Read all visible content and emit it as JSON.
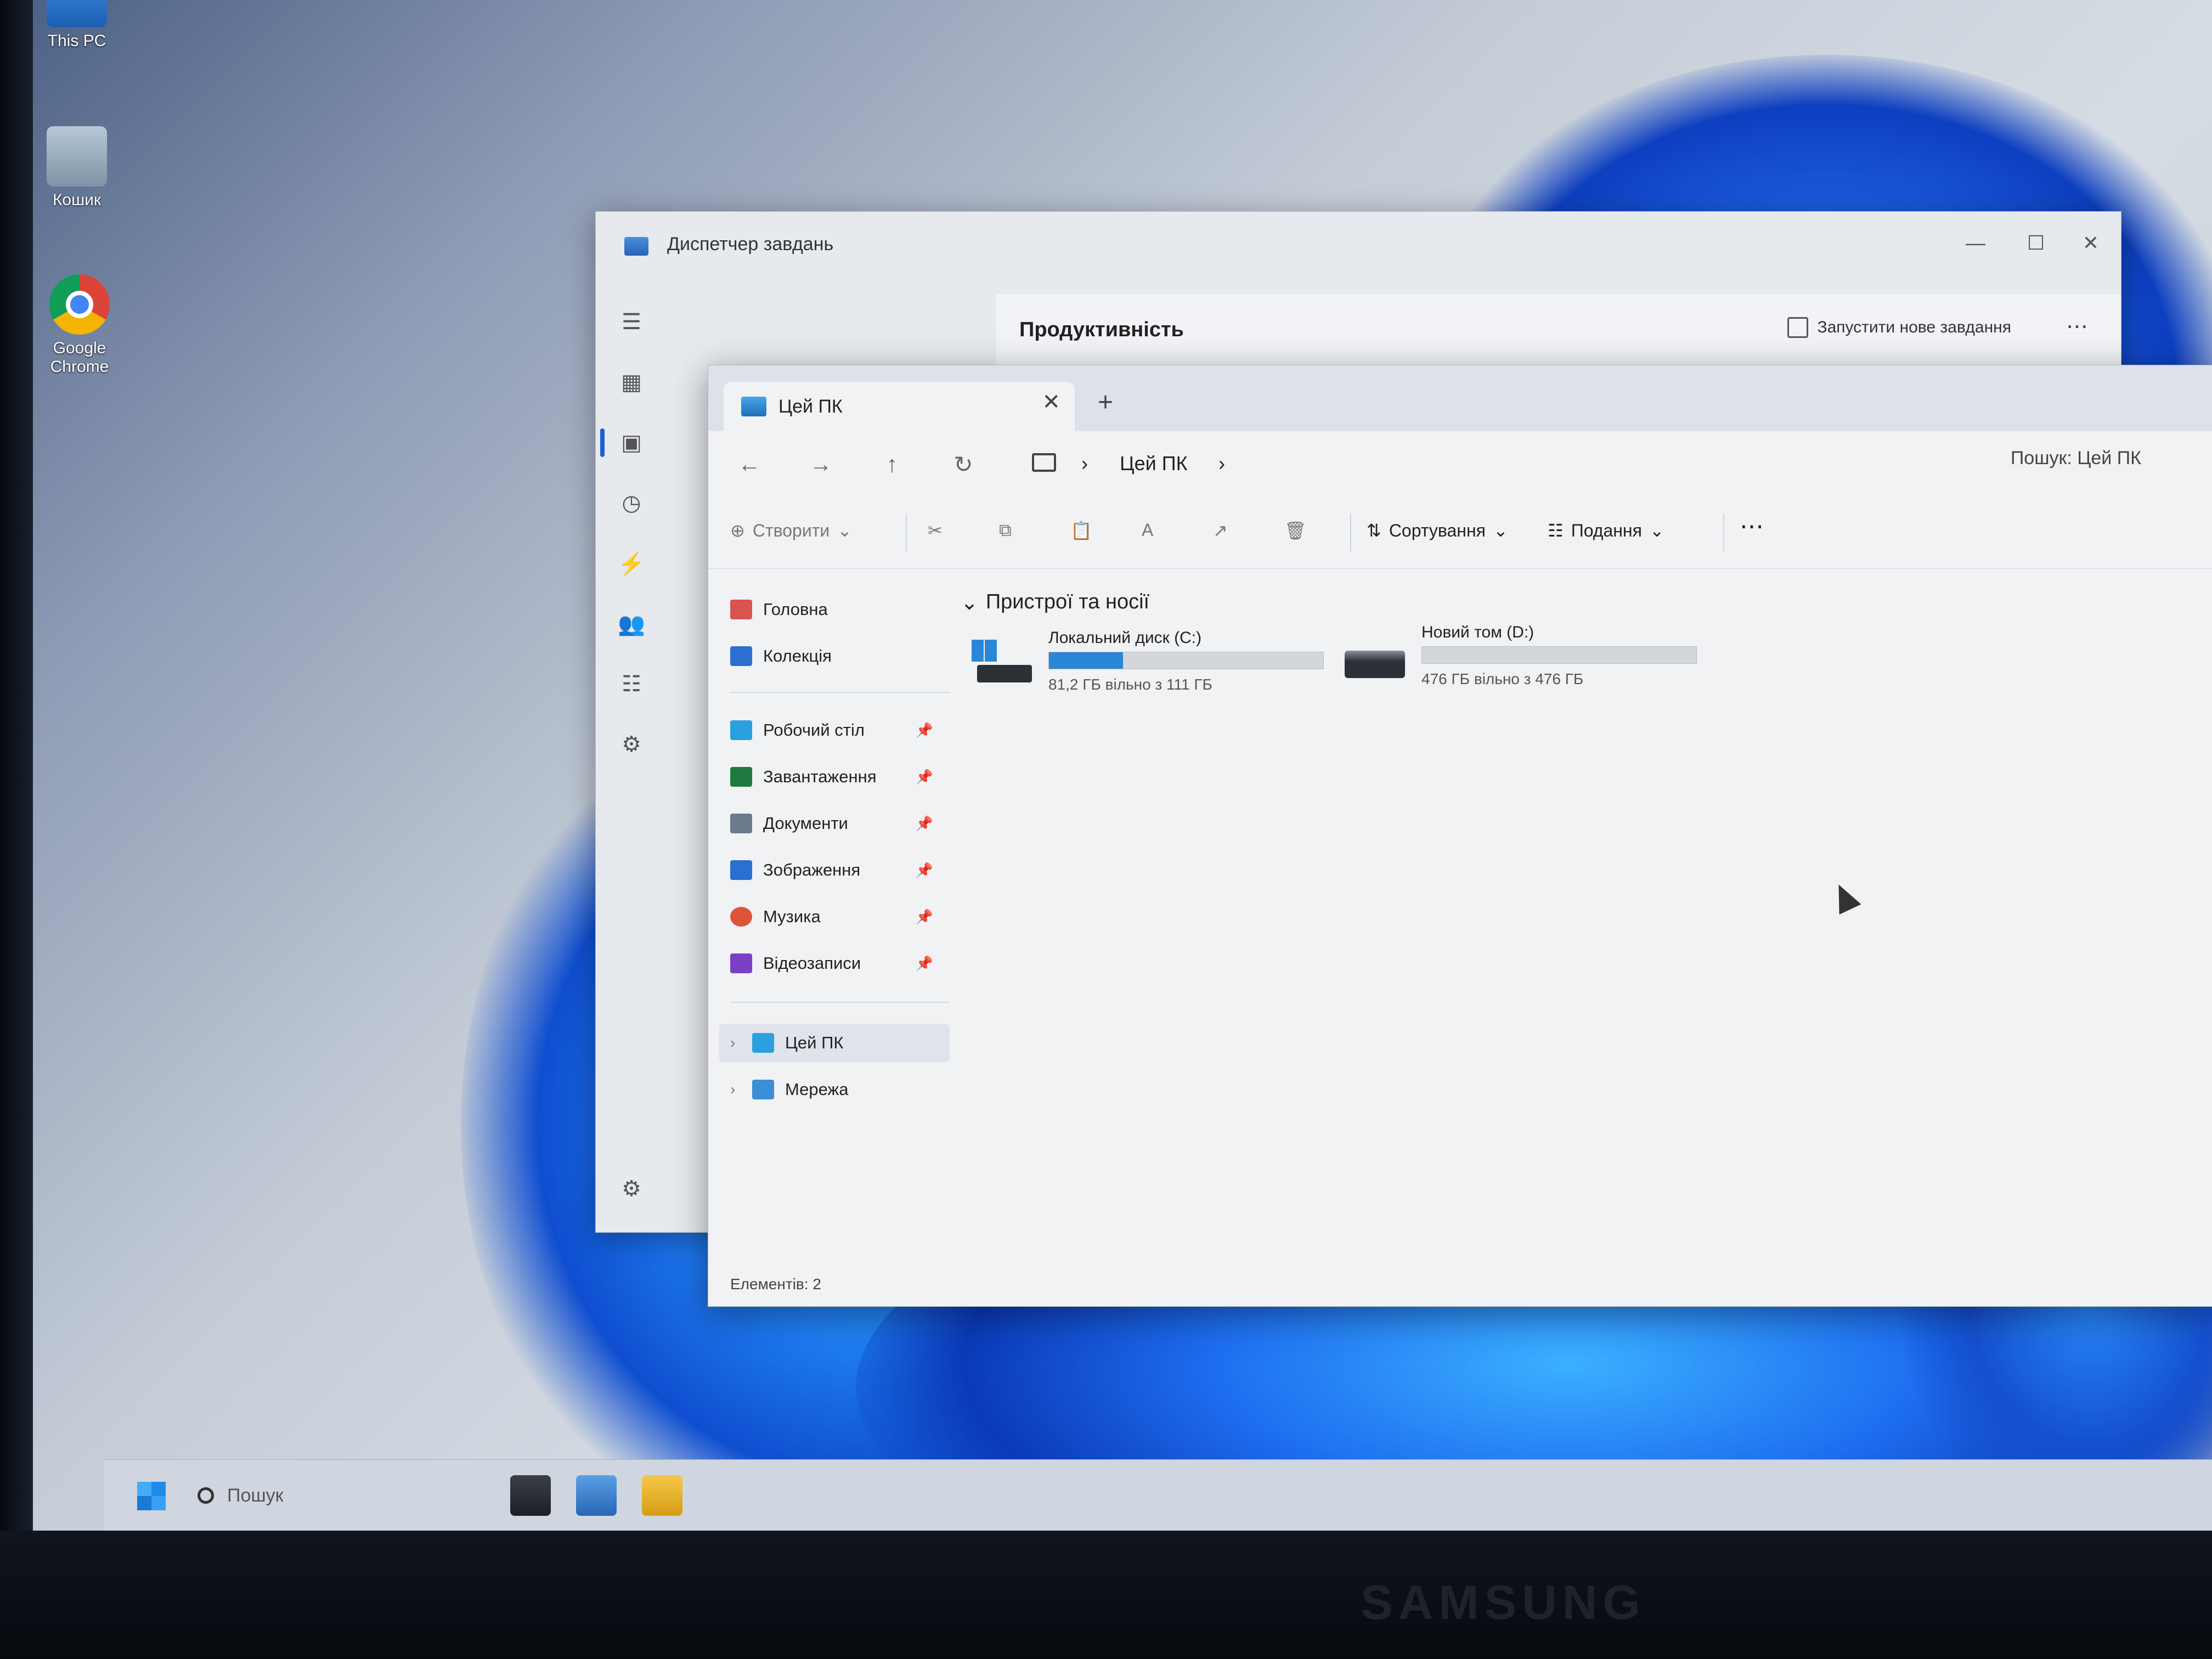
{
  "monitor": {
    "brand": "SAMSUNG"
  },
  "desktop": {
    "icons": [
      {
        "label": "This PC",
        "icon": "computer-icon"
      },
      {
        "label": "Кошик",
        "icon": "recycle-bin-icon"
      },
      {
        "label": "Google Chrome",
        "icon": "chrome-icon"
      }
    ]
  },
  "task_manager": {
    "title": "Диспетчер завдань",
    "section_title": "Продуктивність",
    "run_new_task": "Запустити нове завдання",
    "more": "⋯",
    "window_controls": {
      "minimize": "—",
      "maximize": "☐",
      "close": "✕"
    }
  },
  "explorer": {
    "tab": {
      "label": "Цей ПК",
      "close": "✕"
    },
    "new_tab": "+",
    "address": {
      "crumb": "Цей ПК",
      "separator": "›"
    },
    "search_placeholder": "Пошук: Цей ПК",
    "nav_glyphs": {
      "back": "←",
      "forward": "→",
      "up": "↑",
      "refresh": "↻"
    },
    "toolbar": {
      "create": "Створити",
      "sort": "Сортування",
      "view": "Подання",
      "more": "⋯",
      "dropdown": "⌄",
      "glyphs": {
        "plus": "⊕",
        "cut": "✂",
        "copy": "⧉",
        "paste": "📋",
        "rename": "A",
        "share": "↗",
        "delete": "🗑",
        "sort": "⇅",
        "view": "☷"
      }
    },
    "sidebar": {
      "top": [
        {
          "label": "Головна",
          "icon": "home-icon",
          "color": "#d9534f"
        },
        {
          "label": "Колекція",
          "icon": "gallery-icon",
          "color": "#2a6fd1"
        }
      ],
      "pinned": [
        {
          "label": "Робочий стіл",
          "icon": "desktop-icon",
          "color": "#2aa0e0"
        },
        {
          "label": "Завантаження",
          "icon": "downloads-icon",
          "color": "#1f7a3f"
        },
        {
          "label": "Документи",
          "icon": "documents-icon",
          "color": "#6b7a8c"
        },
        {
          "label": "Зображення",
          "icon": "pictures-icon",
          "color": "#2a6fd1"
        },
        {
          "label": "Музика",
          "icon": "music-icon",
          "color": "#e0533b"
        },
        {
          "label": "Відеозаписи",
          "icon": "videos-icon",
          "color": "#7b3fc4"
        }
      ],
      "pin_glyph": "📌",
      "bottom": [
        {
          "label": "Цей ПК",
          "icon": "this-pc-icon",
          "color": "#2aa0e0",
          "selected": true
        },
        {
          "label": "Мережа",
          "icon": "network-icon",
          "color": "#3b8fd6",
          "selected": false
        }
      ],
      "chevron": "›"
    },
    "group_header": "Пристрої та носії",
    "group_chevron": "⌄",
    "drives": [
      {
        "name": "Локальний диск (C:)",
        "free": "81,2 ГБ вільно з 111 ГБ",
        "used_fraction": 0.27,
        "icon": "windows-drive-icon"
      },
      {
        "name": "Новий том (D:)",
        "free": "476 ГБ вільно з 476 ГБ",
        "used_fraction": 0.0,
        "icon": "hard-drive-icon"
      }
    ],
    "status": "Елементів: 2",
    "accent_color": "#2a86d6"
  },
  "taskbar": {
    "search_placeholder": "Пошук"
  }
}
